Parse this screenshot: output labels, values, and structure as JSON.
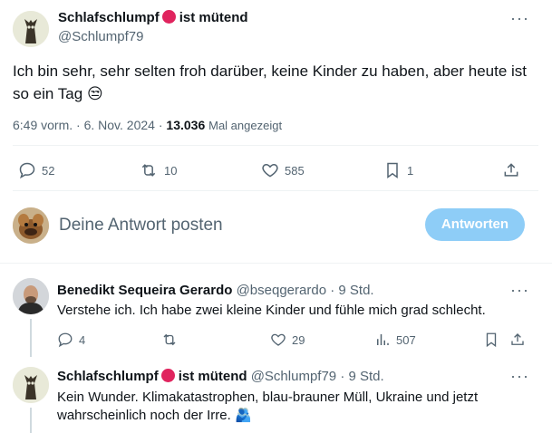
{
  "post": {
    "author_name": "Schlafschlumpf",
    "author_name_suffix": "ist mütend",
    "handle": "@Schlumpf79",
    "text": "Ich bin sehr, sehr selten froh darüber, keine Kinder zu haben, aber heute ist so ein Tag",
    "emoji": "😒",
    "time": "6:49 vorm.",
    "date": "6. Nov. 2024",
    "views_count": "13.036",
    "views_label": "Mal angezeigt",
    "replies": "52",
    "reposts": "10",
    "likes": "585",
    "bookmarks": "1"
  },
  "composer": {
    "placeholder": "Deine Antwort posten",
    "button_label": "Antworten"
  },
  "replies": [
    {
      "author_name": "Benedikt Sequeira Gerardo",
      "handle": "@bseqgerardo",
      "time": "9 Std.",
      "text": "Verstehe ich. Ich habe zwei kleine Kinder und fühle mich grad schlecht.",
      "replies": "4",
      "likes": "29",
      "views": "507"
    },
    {
      "author_name": "Schlafschlumpf",
      "author_name_suffix": "ist mütend",
      "handle": "@Schlumpf79",
      "time": "9 Std.",
      "text": "Kein Wunder. Klimakatastrophen, blau-brauner Müll, Ukraine und jetzt wahrscheinlich noch der Irre.",
      "emoji": "🫂"
    }
  ],
  "colors": {
    "accent": "#1d9bf0",
    "button_disabled": "#8ecdf7",
    "status_dot": "#e0245e",
    "muted_text": "#536471"
  }
}
